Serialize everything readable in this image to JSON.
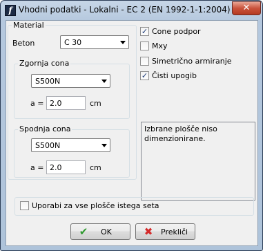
{
  "window": {
    "title": "Vhodni podatki - Lokalni - EC 2 (EN 1992-1-1:2004)",
    "close_glyph": "✕"
  },
  "material": {
    "group_label": "Material",
    "beton_label": "Beton",
    "beton_value": "C 30",
    "zgornja": {
      "label": "Zgornja cona",
      "steel": "S500N",
      "a_label": "a =",
      "a_value": "2.0",
      "unit": "cm"
    },
    "spodnja": {
      "label": "Spodnja cona",
      "steel": "S500N",
      "a_label": "a =",
      "a_value": "2.0",
      "unit": "cm"
    }
  },
  "options": [
    {
      "label": "Cone podpor",
      "checked": true
    },
    {
      "label": "Mxy",
      "checked": false
    },
    {
      "label": "Simetrično armiranje",
      "checked": false
    },
    {
      "label": "Čisti upogib",
      "checked": true
    }
  ],
  "info_text": "Izbrane plošče niso dimenzionirane.",
  "bottom_option": {
    "label": "Uporabi za vse plošče istega seta",
    "checked": false
  },
  "buttons": {
    "ok": "OK",
    "cancel": "Prekliči"
  },
  "colors": {
    "ok_icon": "#2f9a2f",
    "cancel_icon": "#d42a2a",
    "check": "#1c3a77"
  }
}
